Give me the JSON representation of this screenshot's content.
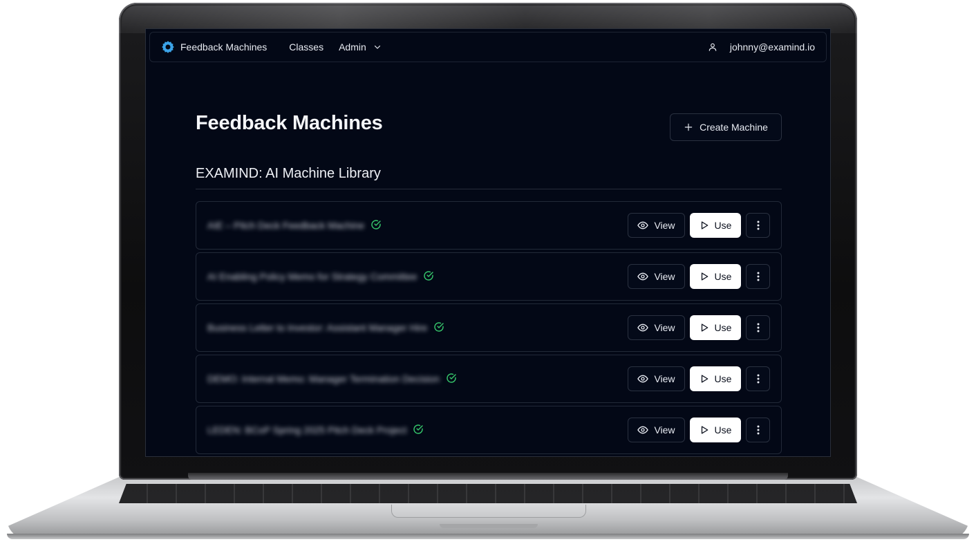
{
  "navbar": {
    "brand": "Feedback Machines",
    "links": [
      "Classes",
      "Admin"
    ],
    "user_email": "johnny@examind.io"
  },
  "page": {
    "title": "Feedback Machines",
    "create_button": "Create Machine",
    "section_title": "EXAMIND: AI Machine Library"
  },
  "machines": [
    {
      "name": "AIE – Pitch Deck Feedback Machine",
      "verified": true
    },
    {
      "name": "AI Enabling Policy Memo for Strategy Committee",
      "verified": true
    },
    {
      "name": "Business Letter to Investor: Assistant Manager Hire",
      "verified": true
    },
    {
      "name": "DEMO: Internal Memo: Manager Termination Decision",
      "verified": true
    },
    {
      "name": "LEDEN: BCoP Spring 2025 Pitch Deck Project",
      "verified": true
    }
  ],
  "row_actions": {
    "view": "View",
    "use": "Use"
  },
  "colors": {
    "background": "#030816",
    "accent_logo": "#3ba3e8",
    "verified_check": "#35c46a",
    "use_button_bg": "#ffffff"
  },
  "icons": {
    "brand": "gear-logo-icon",
    "admin_dropdown": "chevron-down-icon",
    "user": "user-icon",
    "create": "plus-icon",
    "verified": "check-circle-icon",
    "view": "eye-icon",
    "use": "play-icon",
    "more": "more-vertical-icon"
  }
}
